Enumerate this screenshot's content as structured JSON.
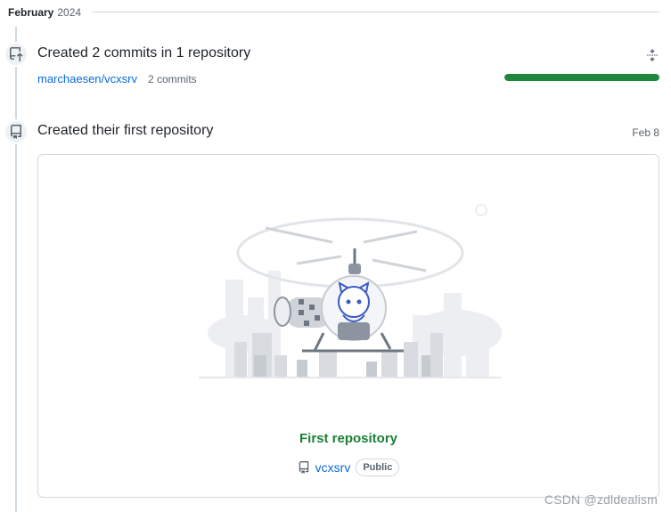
{
  "month": {
    "label": "February",
    "year": "2024"
  },
  "activity1": {
    "title": "Created 2 commits in 1 repository",
    "repo": "marchaesen/vcxsrv",
    "commits": "2 commits",
    "progress": 1.0,
    "icon": "repo-push-icon"
  },
  "activity2": {
    "title": "Created their first repository",
    "date": "Feb 8",
    "icon": "repo-icon",
    "card": {
      "title": "First repository",
      "repo_name": "vcxsrv",
      "visibility": "Public",
      "illustration": "octocat-helicopter-illustration"
    }
  },
  "watermark": "CSDN @zdldealism",
  "colors": {
    "green": "#1a7f37",
    "link": "#0969da",
    "bar": "#1f883d"
  }
}
